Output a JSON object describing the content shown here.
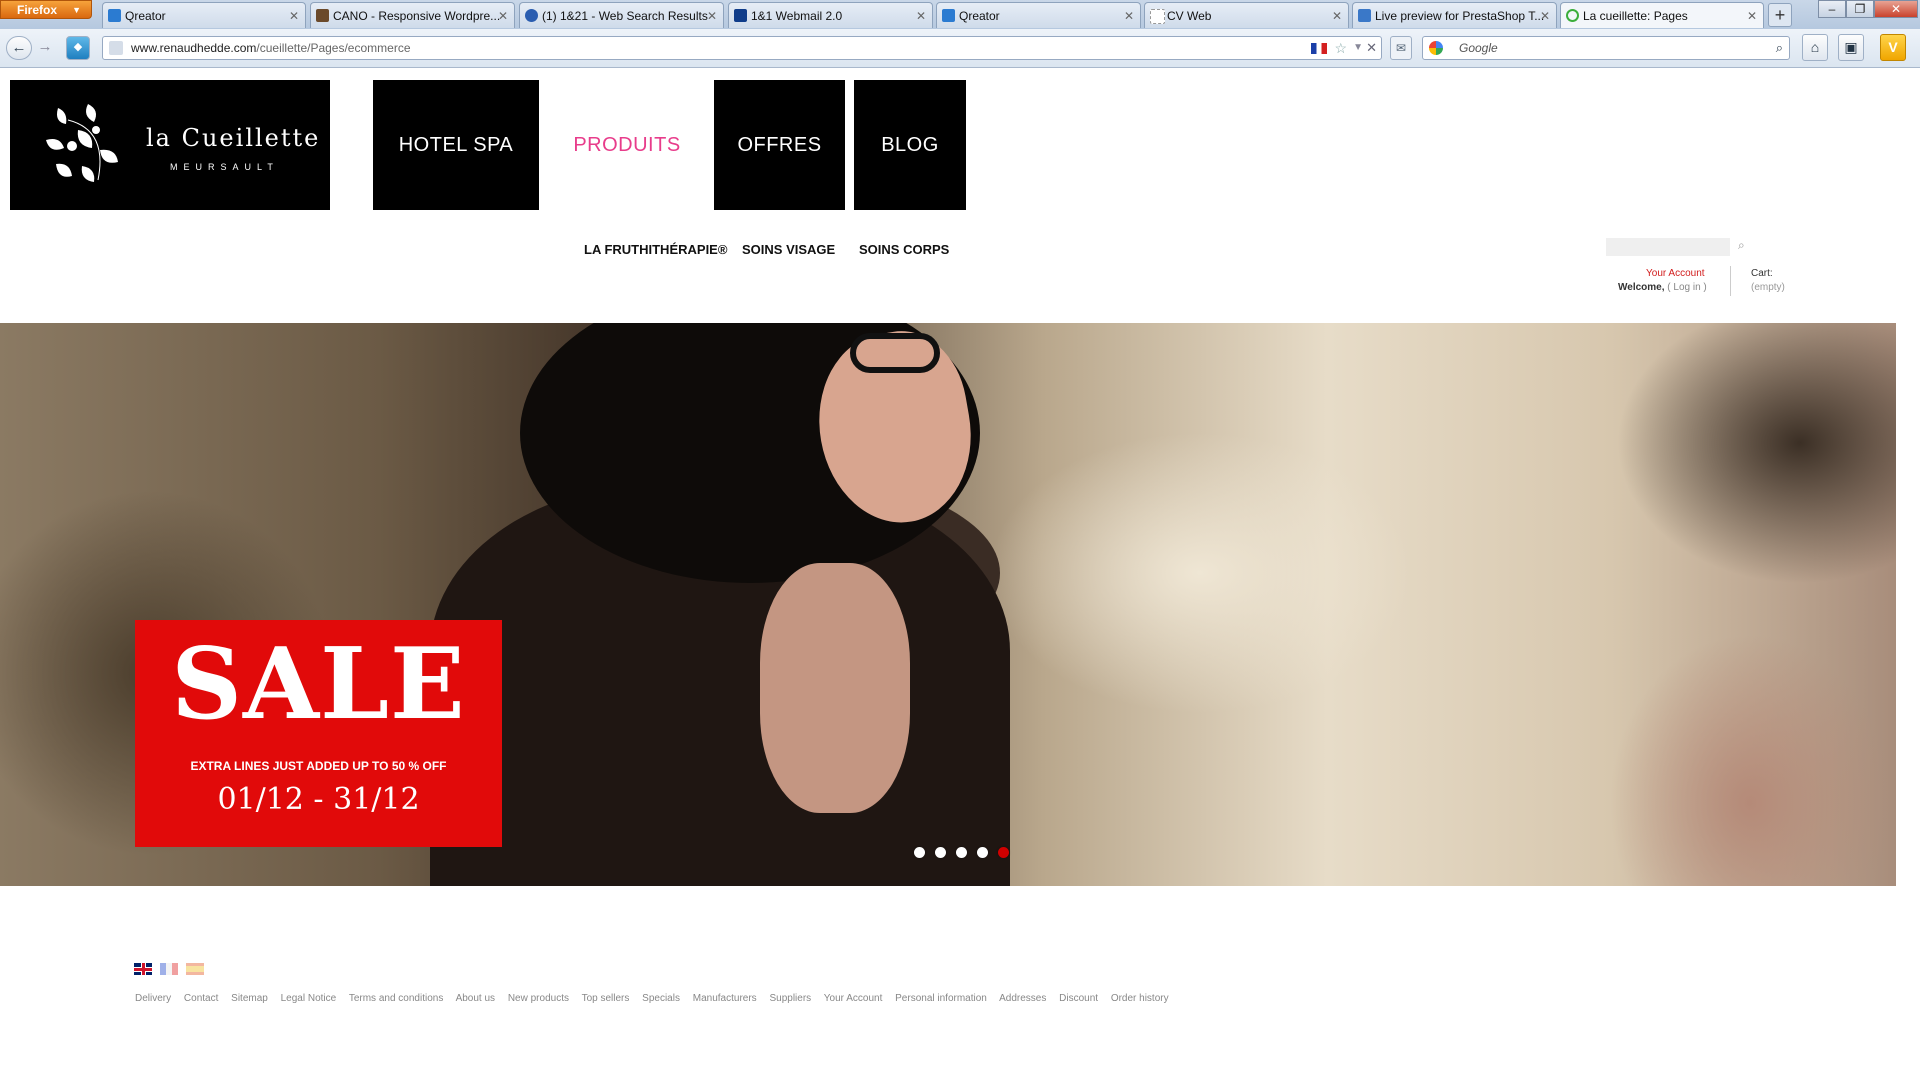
{
  "browser": {
    "menu_label": "Firefox",
    "tabs": [
      {
        "title": "Qreator",
        "color": "#2b7bd1"
      },
      {
        "title": "CANO - Responsive Wordpre...",
        "color": "#6b4a2b"
      },
      {
        "title": "(1) 1&21 - Web Search Results",
        "color": "#2a5db0"
      },
      {
        "title": "1&1 Webmail 2.0",
        "color": "#0f3c8a"
      },
      {
        "title": "Qreator",
        "color": "#2b7bd1"
      },
      {
        "title": "CV Web",
        "color": "#aaaaaa"
      },
      {
        "title": "Live preview for PrestaShop T...",
        "color": "#3a78c8"
      },
      {
        "title": "La cueillette: Pages",
        "color": "#3cae3c"
      }
    ],
    "new_tab": "+",
    "url_domain": "www.renaudhedde.com",
    "url_path": "/cueillette/Pages/ecommerce",
    "search_engine": "Google"
  },
  "site": {
    "logo_name": "la Cueillette",
    "logo_sub": "MEURSAULT",
    "nav": [
      "HOTEL SPA",
      "PRODUITS",
      "OFFRES",
      "BLOG"
    ],
    "nav_active": "PRODUITS",
    "subnav": [
      "LA FRUTHITHÉRAPIE®",
      "SOINS VISAGE",
      "SOINS CORPS"
    ],
    "account_link": "Your Account",
    "welcome": "Welcome,",
    "login": "( Log in )",
    "cart_label": "Cart:",
    "cart_value": "(empty)",
    "accent": "#e83c8b"
  },
  "banner": {
    "headline": "SALE",
    "subline": "EXTRA LINES JUST ADDED UP TO 50 % OFF",
    "dates": "01/12 - 31/12",
    "slide_count": 5,
    "active_slide": 5,
    "sale_color": "#e10a0a"
  },
  "footer": {
    "languages": [
      "en",
      "fr",
      "es"
    ],
    "links": [
      "Delivery",
      "Contact",
      "Sitemap",
      "Legal Notice",
      "Terms and conditions",
      "About us",
      "New products",
      "Top sellers",
      "Specials",
      "Manufacturers",
      "Suppliers",
      "Your Account",
      "Personal information",
      "Addresses",
      "Discount",
      "Order history"
    ]
  }
}
